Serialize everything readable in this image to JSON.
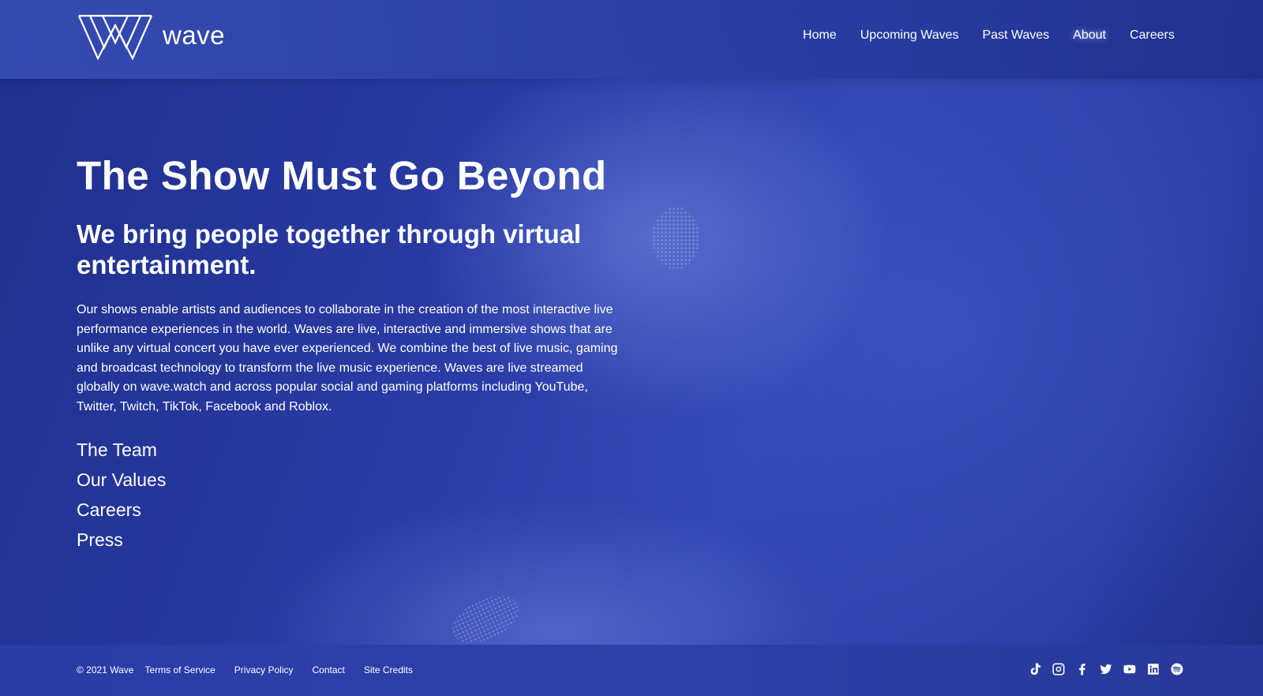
{
  "brand": {
    "name": "wave"
  },
  "nav": {
    "items": [
      {
        "label": "Home"
      },
      {
        "label": "Upcoming Waves"
      },
      {
        "label": "Past Waves"
      },
      {
        "label": "About",
        "active": true
      },
      {
        "label": "Careers"
      }
    ]
  },
  "main": {
    "title": "The Show Must Go Beyond",
    "subtitle": "We bring people together through virtual entertainment.",
    "body": "Our shows enable artists and audiences to collaborate in the creation of the most interactive live performance experiences in the world. Waves are live, interactive and immersive shows that are unlike any virtual concert you have ever experienced. We combine the best of live music, gaming and broadcast technology to transform the live music experience. Waves are live streamed globally on wave.watch and across popular social and gaming platforms including YouTube, Twitter, Twitch, TikTok, Facebook and Roblox.",
    "links": [
      {
        "label": "The Team"
      },
      {
        "label": "Our Values"
      },
      {
        "label": "Careers"
      },
      {
        "label": "Press"
      }
    ]
  },
  "footer": {
    "copyright": "© 2021 Wave",
    "links": [
      {
        "label": "Terms of Service"
      },
      {
        "label": "Privacy Policy"
      },
      {
        "label": "Contact"
      },
      {
        "label": "Site Credits"
      }
    ],
    "socials": [
      "tiktok-icon",
      "instagram-icon",
      "facebook-icon",
      "twitter-icon",
      "youtube-icon",
      "linkedin-icon",
      "spotify-icon"
    ]
  },
  "colors": {
    "background": "#243399",
    "header": "#3043a8",
    "text": "#ffffff"
  }
}
